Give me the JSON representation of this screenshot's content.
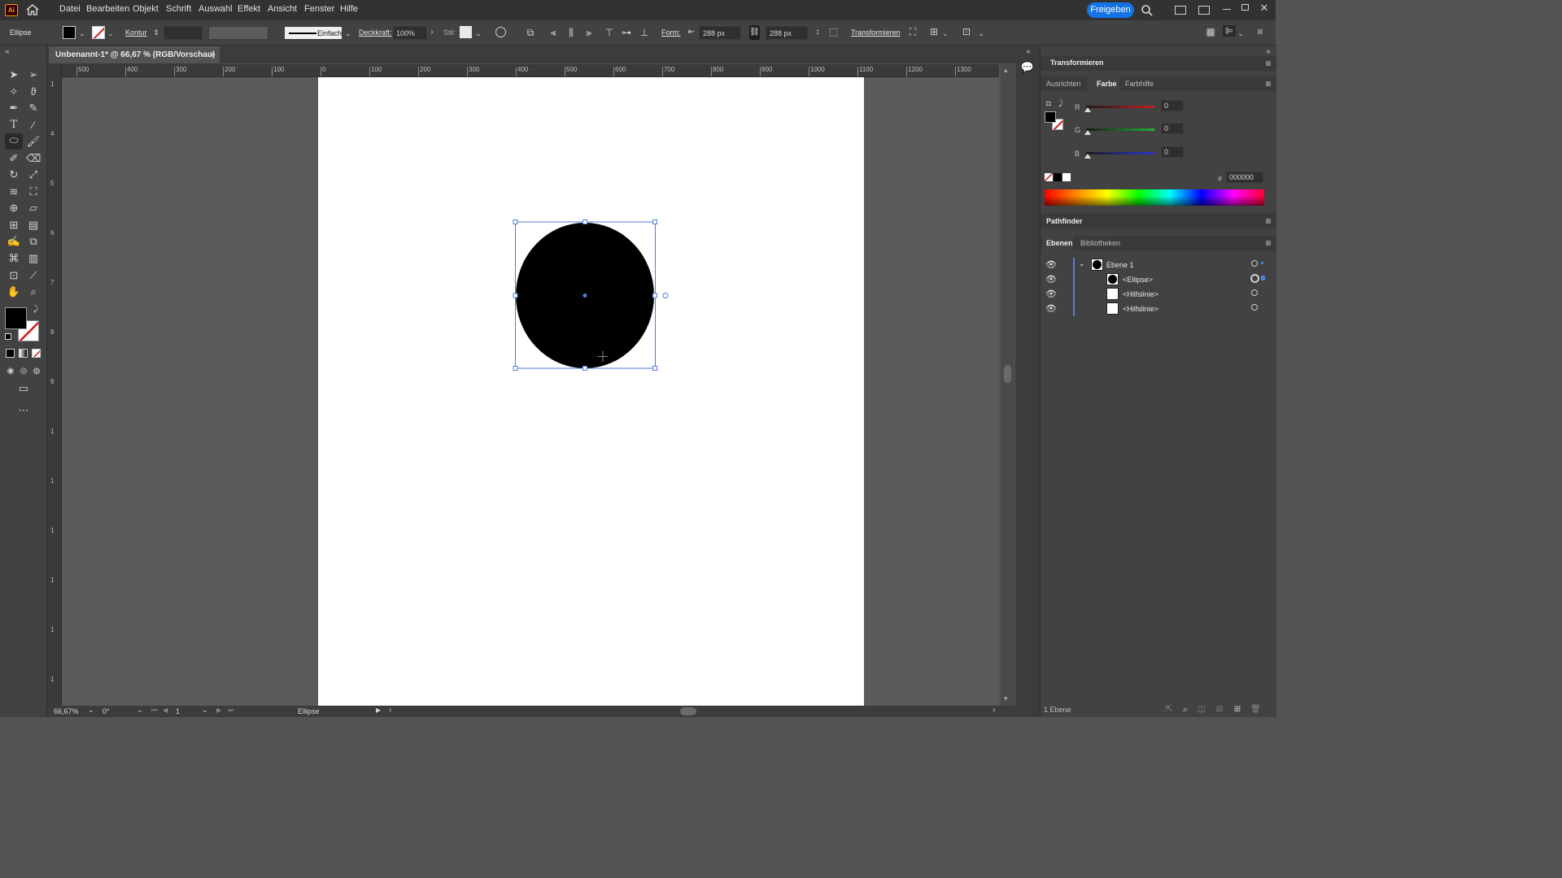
{
  "app": {
    "logo": "Ai",
    "share_label": "Freigeben"
  },
  "menu": [
    "Datei",
    "Bearbeiten",
    "Objekt",
    "Schrift",
    "Auswahl",
    "Effekt",
    "Ansicht",
    "Fenster",
    "Hilfe"
  ],
  "control": {
    "object_type": "Ellipse",
    "stroke_label": "Kontur",
    "stroke_style": "Einfach",
    "opacity_label": "Deckkraft:",
    "opacity_value": "100%",
    "style_label": "Stil:",
    "shape_label": "Form:",
    "width_value": "288 px",
    "height_value": "288 px",
    "transform_label": "Transformieren"
  },
  "document_tab": {
    "title": "Unbenannt-1* @ 66,67 % (RGB/Vorschau)",
    "close": "×"
  },
  "rulers": {
    "h": [
      "500",
      "400",
      "300",
      "200",
      "100",
      "0",
      "100",
      "200",
      "300",
      "400",
      "500",
      "600",
      "700",
      "800",
      "900",
      "1000",
      "1100",
      "1200",
      "1300"
    ],
    "v": [
      "1",
      "4",
      "5",
      "6",
      "7",
      "8",
      "9",
      "1",
      "1",
      "1",
      "1",
      "1",
      "1"
    ]
  },
  "right_panel": {
    "transform_header": "Transformieren",
    "tabs": [
      "Ausrichten",
      "Farbe",
      "Farbhilfe"
    ],
    "color": {
      "channels": [
        {
          "name": "R",
          "value": "0",
          "color": "#c81e1e"
        },
        {
          "name": "G",
          "value": "0",
          "color": "#22b03a"
        },
        {
          "name": "B",
          "value": "0",
          "color": "#2a35d0"
        }
      ],
      "hex_prefix": "#",
      "hex": "000000"
    },
    "pathfinder_header": "Pathfinder",
    "layer_tabs": [
      "Ebenen",
      "Bibliotheken"
    ],
    "layers": [
      {
        "name": "Ebene 1",
        "level": 0
      },
      {
        "name": "<Ellipse>",
        "level": 1
      },
      {
        "name": "<Hilfslinie>",
        "level": 1
      },
      {
        "name": "<Hilfslinie>",
        "level": 1
      }
    ],
    "layer_count": "1 Ebene"
  },
  "status": {
    "zoom": "66,67%",
    "rotation": "0°",
    "artboard": "1",
    "tool": "Ellipse"
  },
  "colors": {
    "accent": "#1473e6",
    "selection": "#4f7fdc",
    "fill": "#000000"
  }
}
